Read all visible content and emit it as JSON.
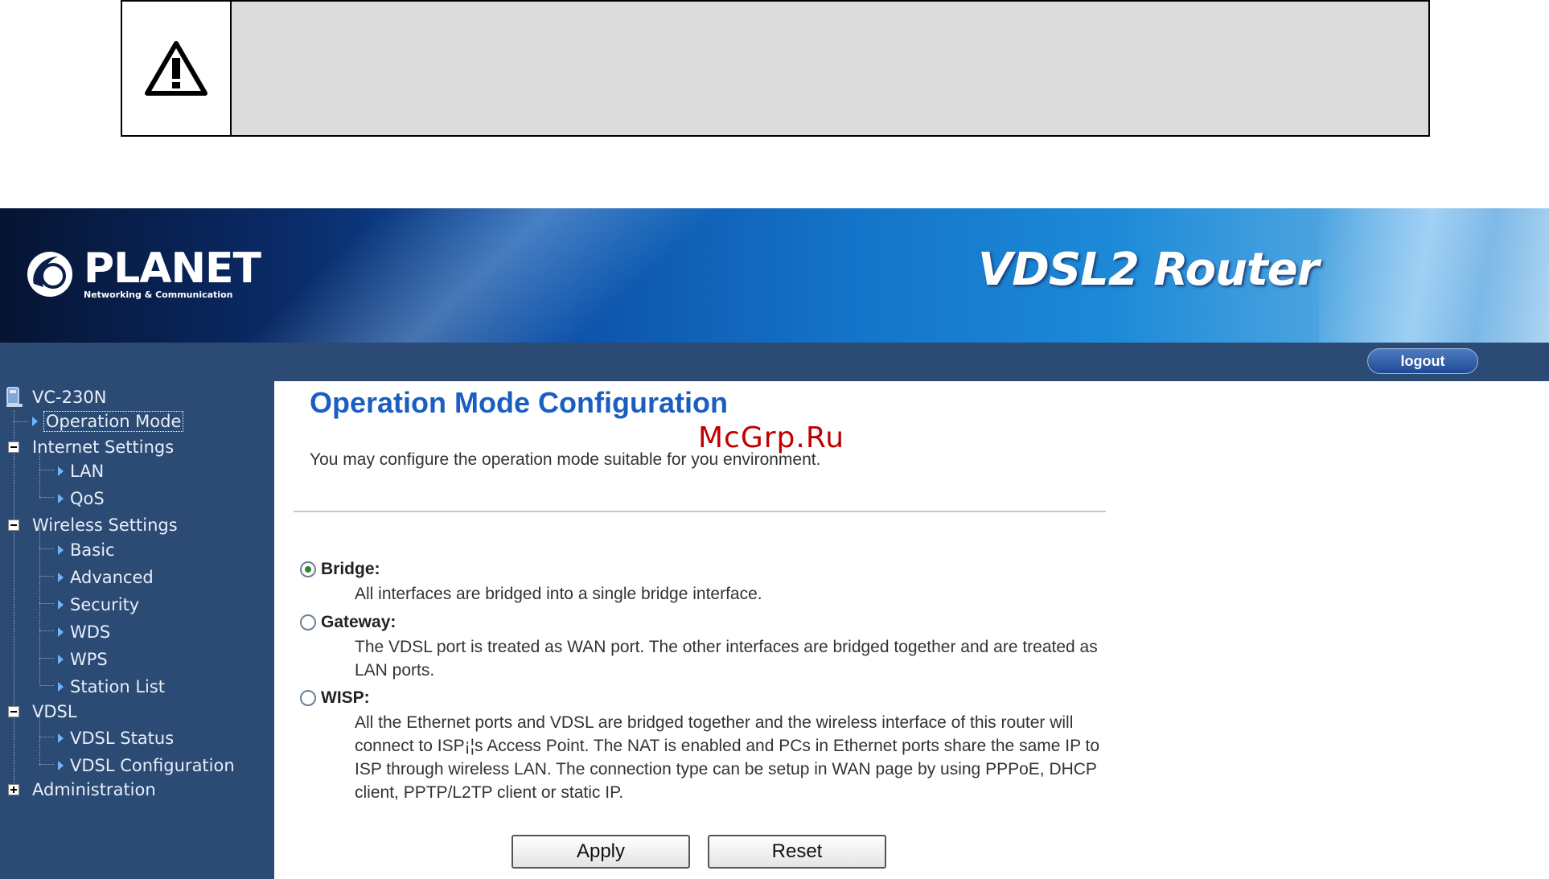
{
  "watermark": "McGrp.Ru",
  "banner": {
    "brand": "PLANET",
    "tagline": "Networking & Communication",
    "product": "VDSL2 Router"
  },
  "topbar": {
    "logout_label": "logout"
  },
  "sidebar": {
    "root": "VC-230N",
    "items": [
      {
        "label": "Operation Mode"
      },
      {
        "label": "Internet Settings"
      },
      {
        "label": "LAN"
      },
      {
        "label": "QoS"
      },
      {
        "label": "Wireless Settings"
      },
      {
        "label": "Basic"
      },
      {
        "label": "Advanced"
      },
      {
        "label": "Security"
      },
      {
        "label": "WDS"
      },
      {
        "label": "WPS"
      },
      {
        "label": "Station List"
      },
      {
        "label": "VDSL"
      },
      {
        "label": "VDSL Status"
      },
      {
        "label": "VDSL Configuration"
      },
      {
        "label": "Administration"
      }
    ]
  },
  "main": {
    "title": "Operation Mode Configuration",
    "intro": "You may configure the operation mode suitable for you environment.",
    "selected": "Bridge",
    "options": [
      {
        "label": "Bridge:",
        "description": "All interfaces are bridged into a single bridge interface."
      },
      {
        "label": "Gateway:",
        "description": "The VDSL port is treated as WAN port. The other interfaces are bridged together and are treated as LAN ports."
      },
      {
        "label": "WISP:",
        "description": "All the Ethernet ports and VDSL are bridged together and the wireless interface of this router will connect to ISP¡¦s Access Point. The NAT is enabled and PCs in Ethernet ports share the same IP to ISP through wireless LAN. The connection type can be setup in WAN page by using PPPoE, DHCP client, PPTP/L2TP client or static IP."
      }
    ],
    "apply_label": "Apply",
    "reset_label": "Reset"
  }
}
